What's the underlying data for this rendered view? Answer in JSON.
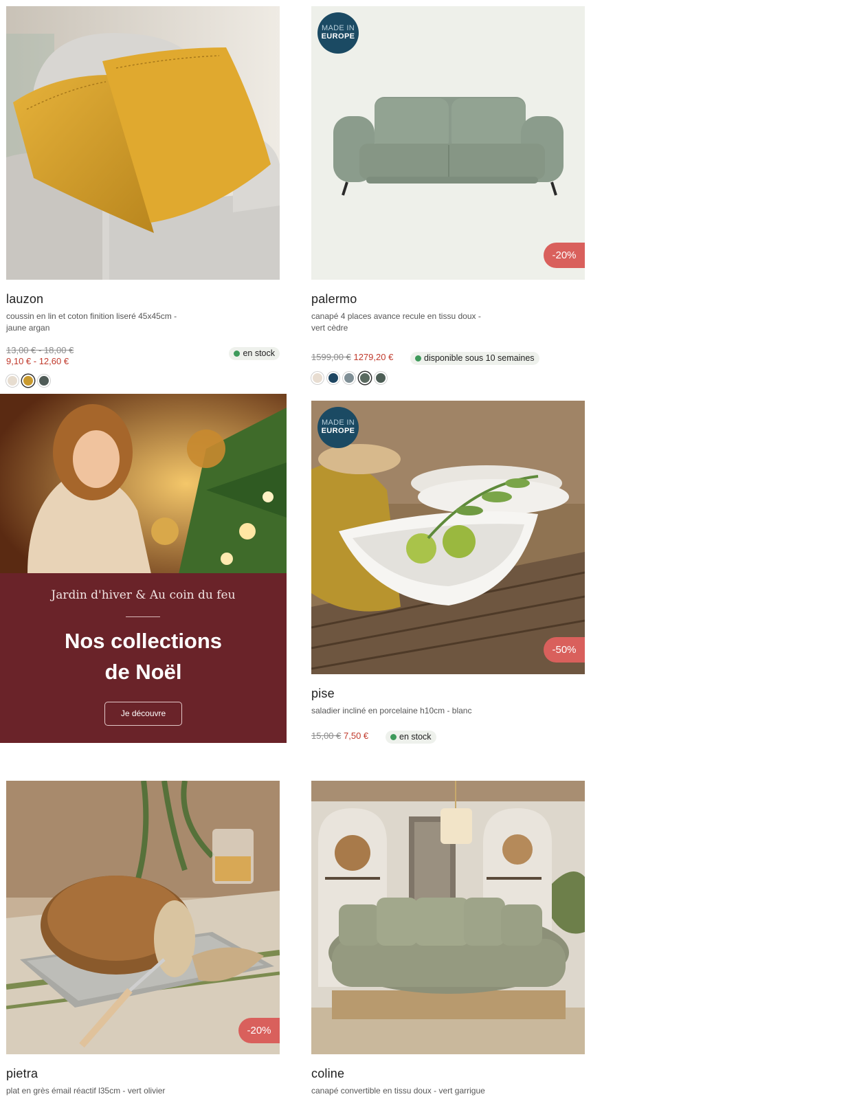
{
  "colors": {
    "accent_price": "#c0392b",
    "discount_badge": "#d9605c",
    "made_in_badge": "#1b4a63",
    "promo_panel": "#6a2329",
    "stock_dot": "#3e9a5b"
  },
  "products": [
    {
      "name": "lauzon",
      "description": "coussin en lin et coton finition liseré 45x45cm - jaune argan",
      "price_old": "13,00 € - 18,00 €",
      "price_new": "9,10 € - 12,60 €",
      "stock": "en stock",
      "swatches": [
        "#e7ddd0",
        "#c99a2e",
        "#4f5b57"
      ],
      "selected_swatch": 1
    },
    {
      "name": "palermo",
      "description": "canapé 4 places avance recule en tissu doux - vert cèdre",
      "price_old": "1599,00 €",
      "price_new": "1279,20 €",
      "stock": "disponible sous 10 semaines",
      "made_in": [
        "MADE IN",
        "EUROPE"
      ],
      "discount": "-20%",
      "swatches": [
        "#e8ddd1",
        "#1e4662",
        "#7f8f96",
        "#5a6a60",
        "#4d5e56"
      ],
      "selected_swatch": 3
    },
    {
      "name": "pise",
      "description": "saladier incliné en porcelaine h10cm - blanc",
      "price_old": "15,00 €",
      "price_new": "7,50 €",
      "stock": "en stock",
      "made_in": [
        "MADE IN",
        "EUROPE"
      ],
      "discount": "-50%"
    },
    {
      "name": "pietra",
      "description": "plat en grès émail réactif l35cm - vert olivier",
      "discount": "-20%"
    },
    {
      "name": "coline",
      "description": "canapé convertible en tissu doux - vert garrigue"
    }
  ],
  "promo": {
    "subtitle": "Jardin d'hiver & Au coin du feu",
    "heading_line1": "Nos collections",
    "heading_line2": "de Noël",
    "button": "Je découvre"
  }
}
